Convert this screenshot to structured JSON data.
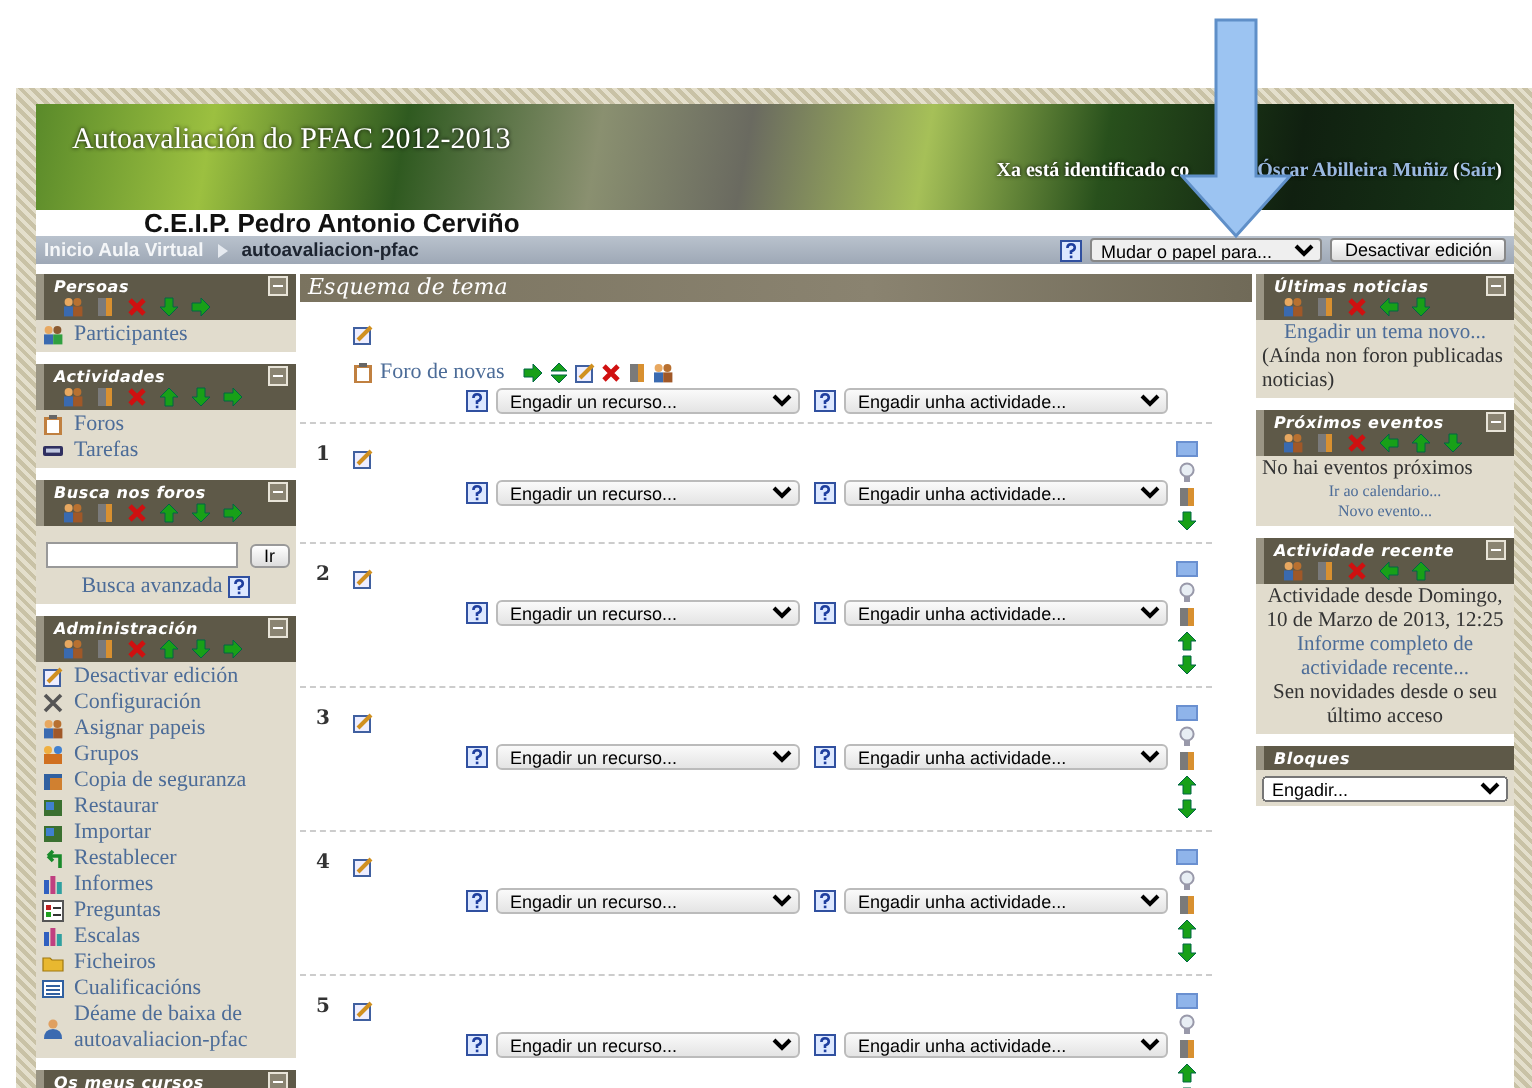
{
  "header": {
    "site_title": "Autoavaliación do PFAC 2012-2013",
    "login": [
      {
        "kind": "covered",
        "text": "Xa está identificado co"
      },
      {
        "kind": "link",
        "text": "Óscar Abilleira Muñiz"
      },
      {
        "kind": "plain",
        "text": " ("
      },
      {
        "kind": "link",
        "text": "Saír"
      },
      {
        "kind": "plain",
        "text": ")"
      }
    ],
    "school": "C.E.I.P. Pedro Antonio Cerviño"
  },
  "navbar": {
    "crumbs": [
      {
        "kind": "link",
        "text": "Inicio Aula Virtual"
      },
      {
        "kind": "current",
        "text": "autoavaliacion-pfac"
      }
    ],
    "role_select": "Mudar o papel para...",
    "edit_button": "Desactivar edición"
  },
  "left_blocks": [
    {
      "kind": "standard",
      "title": "Persoas",
      "items": [
        {
          "kind": "link",
          "text": "Participantes"
        }
      ]
    },
    {
      "kind": "standard",
      "title": "Actividades",
      "items": [
        {
          "kind": "link",
          "text": "Foros"
        },
        {
          "kind": "link",
          "text": "Tarefas"
        }
      ]
    },
    {
      "kind": "standard",
      "title": "Busca nos foros",
      "items": [
        {
          "kind": "search",
          "text": "Ir"
        },
        {
          "kind": "help-link",
          "text": "Busca avanzada"
        }
      ]
    },
    {
      "kind": "standard",
      "title": "Administración",
      "items": [
        {
          "kind": "link",
          "text": "Desactivar edición"
        },
        {
          "kind": "link",
          "text": "Configuración"
        },
        {
          "kind": "link",
          "text": "Asignar papeis"
        },
        {
          "kind": "link",
          "text": "Grupos"
        },
        {
          "kind": "link",
          "text": "Copia de seguranza"
        },
        {
          "kind": "link",
          "text": "Restaurar"
        },
        {
          "kind": "link",
          "text": "Importar"
        },
        {
          "kind": "link",
          "text": "Restablecer"
        },
        {
          "kind": "link",
          "text": "Informes"
        },
        {
          "kind": "link",
          "text": "Preguntas"
        },
        {
          "kind": "link",
          "text": "Escalas"
        },
        {
          "kind": "link",
          "text": "Ficheiros"
        },
        {
          "kind": "link",
          "text": "Cualificacións"
        },
        {
          "kind": "link",
          "text": "Déame de baixa de autoavaliacion-pfac"
        }
      ]
    },
    {
      "kind": "standard",
      "title": "Os meus cursos"
    }
  ],
  "main": {
    "title": "Esquema de tema",
    "sections": [
      {
        "activities": [
          {
            "name": "Foro de novas"
          }
        ],
        "resource_select": "Engadir un recurso...",
        "activity_select": "Engadir unha actividade..."
      },
      {
        "number": "1",
        "resource_select": "Engadir un recurso...",
        "activity_select": "Engadir unha actividade..."
      },
      {
        "number": "2",
        "resource_select": "Engadir un recurso...",
        "activity_select": "Engadir unha actividade..."
      },
      {
        "number": "3",
        "resource_select": "Engadir un recurso...",
        "activity_select": "Engadir unha actividade..."
      },
      {
        "number": "4",
        "resource_select": "Engadir un recurso...",
        "activity_select": "Engadir unha actividade..."
      },
      {
        "number": "5",
        "resource_select": "Engadir un recurso...",
        "activity_select": "Engadir unha actividade..."
      }
    ]
  },
  "right_blocks": [
    {
      "kind": "standard",
      "title": "Últimas noticias",
      "items": [
        {
          "kind": "center-link",
          "text": "Engadir un tema novo..."
        },
        {
          "kind": "text",
          "text": "(Aínda non foron publicadas noticias)"
        }
      ]
    },
    {
      "kind": "standard",
      "title": "Próximos eventos",
      "items": [
        {
          "kind": "text",
          "text": "No hai eventos próximos"
        },
        {
          "kind": "small-link",
          "text": "Ir ao calendario..."
        },
        {
          "kind": "small-link",
          "text": "Novo evento..."
        }
      ]
    },
    {
      "kind": "standard",
      "title": "Actividade recente",
      "items": [
        {
          "kind": "center-text",
          "text": "Actividade desde Domingo, 10 de Marzo de 2013, 12:25"
        },
        {
          "kind": "center-link",
          "text": "Informe completo de actividade recente..."
        },
        {
          "kind": "center-text",
          "text": "Sen novidades desde o seu último acceso"
        }
      ]
    },
    {
      "kind": "add",
      "title": "Bloques",
      "items": [
        {
          "kind": "select",
          "text": "Engadir..."
        }
      ]
    }
  ]
}
